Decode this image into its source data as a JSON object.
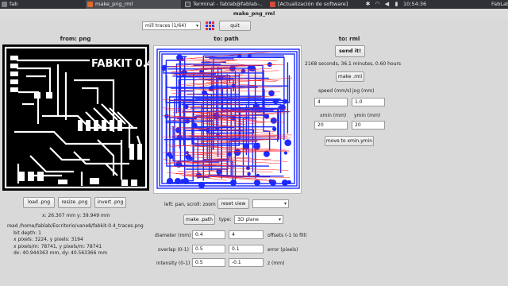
{
  "taskbar": {
    "apps": [
      {
        "label": "fab",
        "color": "#7c7f86"
      },
      {
        "label": "make_png_rml",
        "color": "#e06a2b"
      },
      {
        "label": "Terminal - fablab@fablab-...",
        "color": "#444a52"
      },
      {
        "label": "[Actualización de software]",
        "color": "#d24a3a"
      }
    ],
    "clock": "10:54:36",
    "user": "FabLab"
  },
  "window_title": "make_png_rml",
  "toolbar": {
    "mode_select": "mill traces (1/64)",
    "quit_label": "quit"
  },
  "panels": {
    "from_header": "from: png",
    "path_header": "to: path",
    "rml_header": "to: rml"
  },
  "board": {
    "title": "FABKIT 0.4"
  },
  "left": {
    "load_label": "load .png",
    "resize_label": "resize .png",
    "invert_label": "invert .png",
    "coords": "x: 26.307 mm  y: 39.949 mm",
    "info": [
      "read /home/fablab/Escritorio/vane8/fabkit-0.4_traces.png",
      "bit depth: 1",
      "x pixels: 3224, y pixels: 3194",
      "x pixels/m: 78741, y pixels/m: 78741",
      "dx: 40.944363 mm, dy: 40.563366 mm"
    ]
  },
  "middle": {
    "hint": "left: pan, scroll: zoom",
    "reset_view_label": "reset view",
    "make_path_label": "make .path",
    "type_label": "type:",
    "type_value": "3D plane",
    "diameter_label": "diameter (mm)",
    "diameter_value": "0.4",
    "offsets_value": "4",
    "offsets_label": "offsets (-1 to fill)",
    "overlap_label": "overlap (0-1)",
    "overlap_value": "0.5",
    "error_value": "0.1",
    "error_label": "error (pixels)",
    "intensity_label": "intensity (0-1)",
    "intensity_value": "0.5",
    "z_value": "-0.1",
    "z_label": "z (mm)"
  },
  "right": {
    "send_label": "send it!",
    "time_text": "2168 seconds, 36.1 minutes, 0.60 hours",
    "make_rml_label": "make .rml",
    "speed_label": "speed (mm/s)",
    "jog_label": "jog (mm)",
    "speed_value": "4",
    "jog_value": "1.0",
    "xmin_label": "xmin (mm)",
    "ymin_label": "ymin (mm)",
    "xmin_value": "20",
    "ymin_value": "20",
    "move_label": "move to xmin,ymin"
  },
  "colors": {
    "path_blue": "#1c2bff",
    "path_red": "#ff2020",
    "board_black": "#000000"
  }
}
